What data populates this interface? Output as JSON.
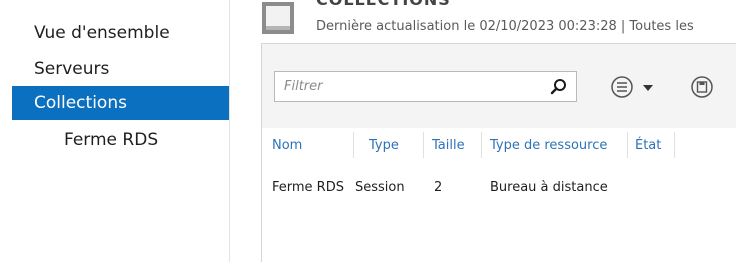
{
  "sidebar": {
    "items": [
      {
        "label": "Vue d'ensemble"
      },
      {
        "label": "Serveurs"
      },
      {
        "label": "Collections"
      },
      {
        "label": "Ferme RDS"
      }
    ]
  },
  "header": {
    "title": "COLLECTIONS",
    "subtitle": "Dernière actualisation le 02/10/2023 00:23:28 | Toutes les"
  },
  "toolbar": {
    "filter_placeholder": "Filtrer",
    "icons": [
      "search-icon",
      "list-options-icon",
      "chevron-down-icon",
      "save-query-icon"
    ]
  },
  "table": {
    "columns": [
      "Nom",
      "Type",
      "Taille",
      "Type de ressource",
      "État"
    ],
    "rows": [
      [
        "Ferme RDS",
        "Session",
        "2",
        "Bureau à distance",
        ""
      ]
    ]
  },
  "colors": {
    "selected_nav": "#0c70c0",
    "column_header": "#2e73b8",
    "toolbar_bg": "#f4f4f4"
  }
}
